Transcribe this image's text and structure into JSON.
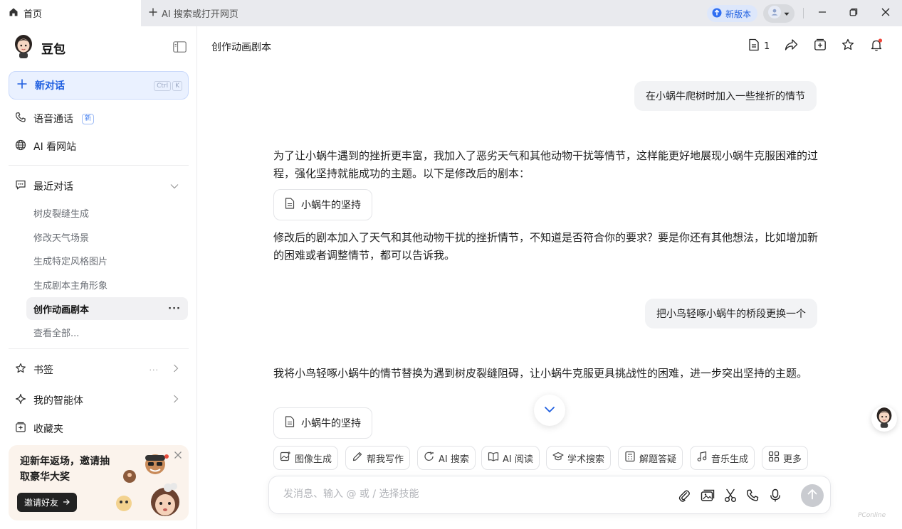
{
  "browser": {
    "home_tab": "首页",
    "new_tab": "AI 搜索或打开网页",
    "update_label": "新版本"
  },
  "sidebar": {
    "app_name": "豆包",
    "new_chat": "新对话",
    "shortcut": [
      "Ctrl",
      "K"
    ],
    "voice_call": "语音通话",
    "voice_badge": "新",
    "ai_browse": "AI 看网站",
    "recent": "最近对话",
    "history": [
      "树皮裂缝生成",
      "修改天气场景",
      "生成特定风格图片",
      "生成剧本主角形象",
      "创作动画剧本"
    ],
    "view_all": "查看全部...",
    "bookmarks": "书签",
    "agents": "我的智能体",
    "favorites": "收藏夹",
    "promo": {
      "text": "迎新年返场，邀请抽取豪华大奖",
      "button": "邀请好友"
    }
  },
  "main": {
    "title": "创作动画剧本",
    "doc_count": "1",
    "messages": {
      "user_1": "在小蜗牛爬树时加入一些挫折的情节",
      "ai_1a": "为了让小蜗牛遇到的挫折更丰富，我加入了恶劣天气和其他动物干扰等情节，这样能更好地展现小蜗牛克服困难的过程，强化坚持就能成功的主题。以下是修改后的剧本：",
      "file_1": "小蜗牛的坚持",
      "ai_1b": "修改后的剧本加入了天气和其他动物干扰的挫折情节，不知道是否符合你的要求？要是你还有其他想法，比如增加新的困难或者调整情节，都可以告诉我。",
      "user_2": "把小鸟轻啄小蜗牛的桥段更换一个",
      "ai_2a": "我将小鸟轻啄小蜗牛的情节替换为遇到树皮裂缝阻碍，让小蜗牛克服更具挑战性的困难，进一步突出坚持的主题。",
      "file_2": "小蜗牛的坚持"
    },
    "skills": [
      "图像生成",
      "帮我写作",
      "AI 搜索",
      "AI 阅读",
      "学术搜索",
      "解题答疑",
      "音乐生成",
      "更多"
    ],
    "composer_placeholder": "发消息、输入 @ 或 / 选择技能"
  },
  "watermark": "PConline",
  "colors": {
    "accent": "#1f5fe0",
    "accent_bg": "#eaf1ff",
    "bubble_bg": "#f2f3f5"
  }
}
